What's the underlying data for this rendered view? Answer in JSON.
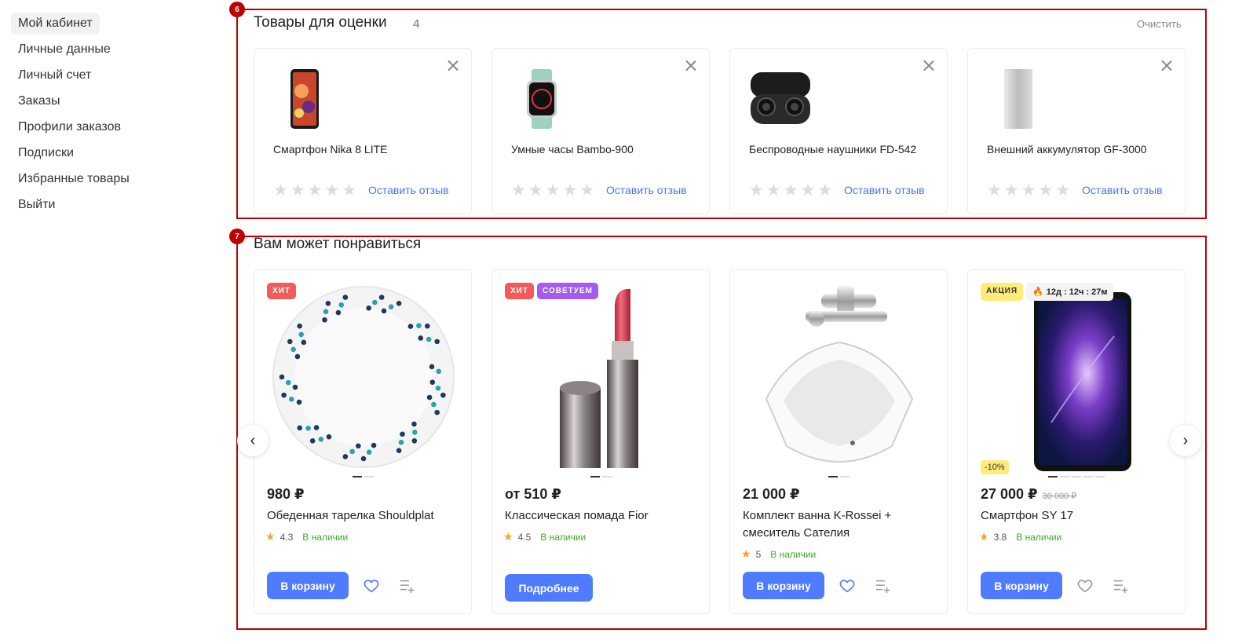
{
  "sidebar": {
    "items": [
      {
        "label": "Мой кабинет",
        "active": true
      },
      {
        "label": "Личные данные"
      },
      {
        "label": "Личный счет"
      },
      {
        "label": "Заказы"
      },
      {
        "label": "Профили заказов"
      },
      {
        "label": "Подписки"
      },
      {
        "label": "Избранные товары"
      },
      {
        "label": "Выйти"
      }
    ]
  },
  "annotations": {
    "section6": "6",
    "section7": "7"
  },
  "review_section": {
    "title": "Товары для оценки",
    "count": "4",
    "clear_label": "Очистить",
    "items": [
      {
        "name": "Смартфон Nika 8 LITE",
        "action": "Оставить отзыв",
        "image": "smartphone-image"
      },
      {
        "name": "Умные часы Bambo-900",
        "action": "Оставить отзыв",
        "image": "smartwatch-image"
      },
      {
        "name": "Беспроводные наушники FD-542",
        "action": "Оставить отзыв",
        "image": "earbuds-image"
      },
      {
        "name": "Внешний аккумулятор GF-3000",
        "action": "Оставить отзыв",
        "image": "powerbank-image"
      }
    ]
  },
  "recommend_section": {
    "title": "Вам может понравиться",
    "products": [
      {
        "labels": [
          "ХИТ"
        ],
        "price": "980 ₽",
        "title": "Обеденная тарелка Shouldplat",
        "rating": "4.3",
        "availability": "В наличии",
        "button": "В корзину"
      },
      {
        "labels": [
          "ХИТ",
          "СОВЕТУЕМ"
        ],
        "price": "от 510 ₽",
        "title": "Классическая помада Fior",
        "rating": "4.5",
        "availability": "В наличии",
        "button": "Подробнее"
      },
      {
        "labels": [],
        "price": "21 000 ₽",
        "title": "Комплект ванна K-Rossei + смеситель Сателия",
        "rating": "5",
        "availability": "В наличии",
        "button": "В корзину"
      },
      {
        "labels": [
          "АКЦИЯ"
        ],
        "timer": "12д : 12ч : 27м",
        "discount": "-10%",
        "price": "27 000 ₽",
        "old_price": "30 000 ₽",
        "title": "Смартфон SY 17",
        "rating": "3.8",
        "availability": "В наличии",
        "button": "В корзину"
      }
    ]
  },
  "colors": {
    "accent": "#4f7bff",
    "frame": "#c00000",
    "hit": "#f15b5b",
    "recommend": "#a35bf1",
    "promo": "#ffeb7a",
    "in_stock": "#3dab26",
    "star": "#f7a32d"
  }
}
